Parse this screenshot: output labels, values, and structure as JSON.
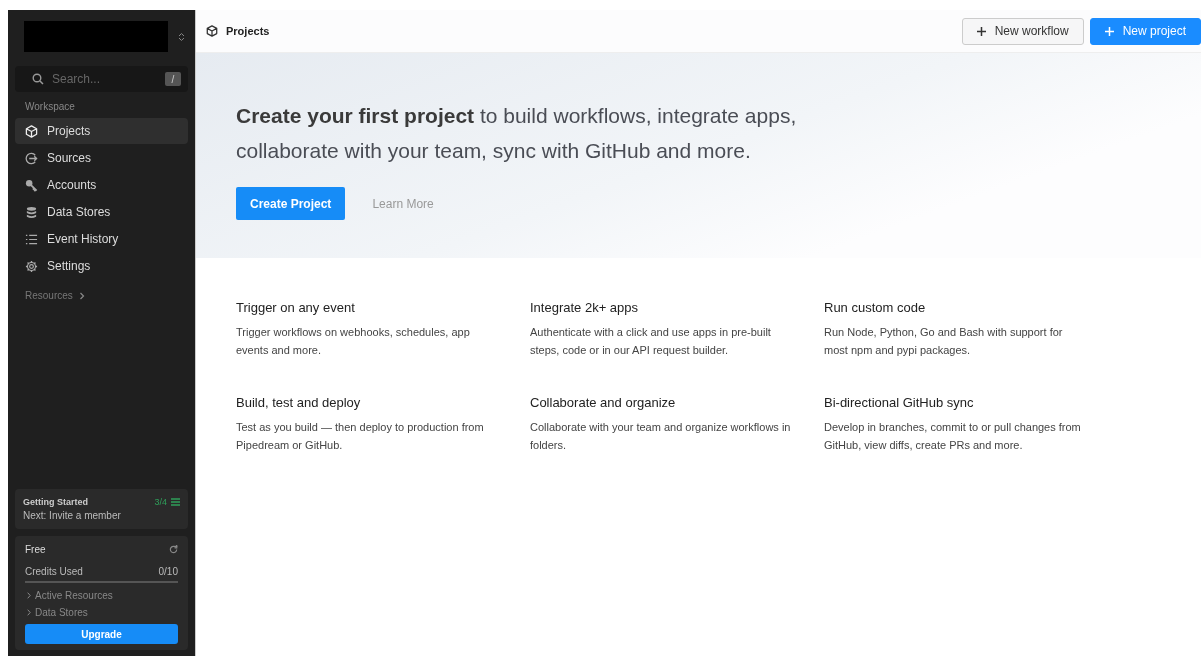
{
  "sidebar": {
    "search": {
      "placeholder": "Search...",
      "shortcut": "/"
    },
    "section_label": "Workspace",
    "items": [
      {
        "label": "Projects",
        "selected": true
      },
      {
        "label": "Sources",
        "selected": false
      },
      {
        "label": "Accounts",
        "selected": false
      },
      {
        "label": "Data Stores",
        "selected": false
      },
      {
        "label": "Event History",
        "selected": false
      },
      {
        "label": "Settings",
        "selected": false
      }
    ],
    "resources_label": "Resources",
    "getting_started": {
      "title": "Getting Started",
      "progress": "3/4",
      "next": "Next: Invite a member"
    },
    "plan": {
      "name": "Free",
      "credits_label": "Credits Used",
      "credits": "0/10",
      "level": 0,
      "links": [
        "Active Resources",
        "Data Stores"
      ],
      "button": "Upgrade"
    }
  },
  "header": {
    "title": "Projects",
    "buttons": [
      {
        "label": "New workflow",
        "kind": "secondary"
      },
      {
        "label": "New project",
        "kind": "primary"
      }
    ]
  },
  "hero": {
    "headline": "**Create your first project** to build workflows, integrate apps, collaborate with your team, sync with GitHub and more.",
    "primary_button": "Create Project",
    "link": "Learn More"
  },
  "features": [
    {
      "title": "Trigger on any event",
      "text": "Trigger workflows on webhooks, schedules, app events and more."
    },
    {
      "title": "Integrate 2k+ apps",
      "text": "Authenticate with a click and use apps in pre-built steps, code or in our API request builder."
    },
    {
      "title": "Run custom code",
      "text": "Run Node, Python, Go and Bash with support for most npm and pypi packages."
    },
    {
      "title": "Build, test and deploy",
      "text": "Test as you build — then deploy to production from Pipedream or GitHub."
    },
    {
      "title": "Collaborate and organize",
      "text": "Collaborate with your team and organize workflows in folders."
    },
    {
      "title": "Bi-directional GitHub sync",
      "text": "Develop in branches, commit to or pull changes from GitHub, view diffs, create PRs and more."
    }
  ]
}
